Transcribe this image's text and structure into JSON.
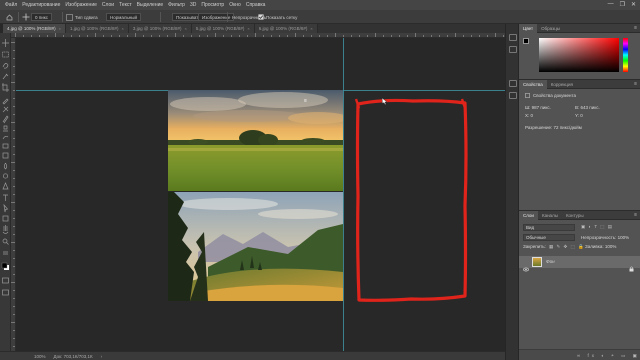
{
  "menu": [
    "Файл",
    "Редактирование",
    "Изображение",
    "Слои",
    "Текст",
    "Выделение",
    "Фильтр",
    "3D",
    "Просмотр",
    "Окно",
    "Справка"
  ],
  "window_controls": [
    "—",
    "❐",
    "✕"
  ],
  "options": {
    "feather_value": "0 пикс",
    "style_value": "Нормальный",
    "mode_label": "Тип сдвига",
    "sample_select": "Показывать рамку",
    "image_btn": "Изображение",
    "transparency": "Непрозрачность",
    "show_panel": "Показать сетку"
  },
  "tabs": [
    {
      "label": "4.jpg @ 100% (RGB/8#)",
      "active": true
    },
    {
      "label": "1.jpg @ 100% (RGB/8#)",
      "active": false
    },
    {
      "label": "3.jpg @ 100% (RGB/8#)",
      "active": false
    },
    {
      "label": "5.jpg @ 100% (RGB/8#)",
      "active": false
    },
    {
      "label": "6.jpg @ 100% (RGB/8#)",
      "active": false
    }
  ],
  "status": {
    "zoom": "100%",
    "doc": "Док: 703,1К/703,1К"
  },
  "color_panel": {
    "tabs": [
      "Цвет",
      "Образцы"
    ],
    "foreground": "#000000",
    "background": "#ffffff",
    "hue_color": "#ff0000"
  },
  "properties_panel": {
    "tabs": [
      "Свойства",
      "Коррекция"
    ],
    "doc_label": "Свойства документа",
    "w_label": "Ш: 987 пикс.",
    "h_label": "В: 643 пикс.",
    "x_label": "X: 0",
    "y_label": "Y: 0",
    "resolution": "Разрешение: 72 пикс/дюйм"
  },
  "layers_panel": {
    "tabs": [
      "Слои",
      "Каналы",
      "Контуры"
    ],
    "kind_filter": "Вид",
    "blend_mode": "Обычные",
    "opacity": "Непрозрачность: 100%",
    "lock_label": "Закрепить:",
    "fill": "Заливка: 100%",
    "layer_name": "Фон"
  },
  "colors": {
    "frame": "#e0241b",
    "guide": "#3f8fa0",
    "panel_bg": "#535353"
  }
}
